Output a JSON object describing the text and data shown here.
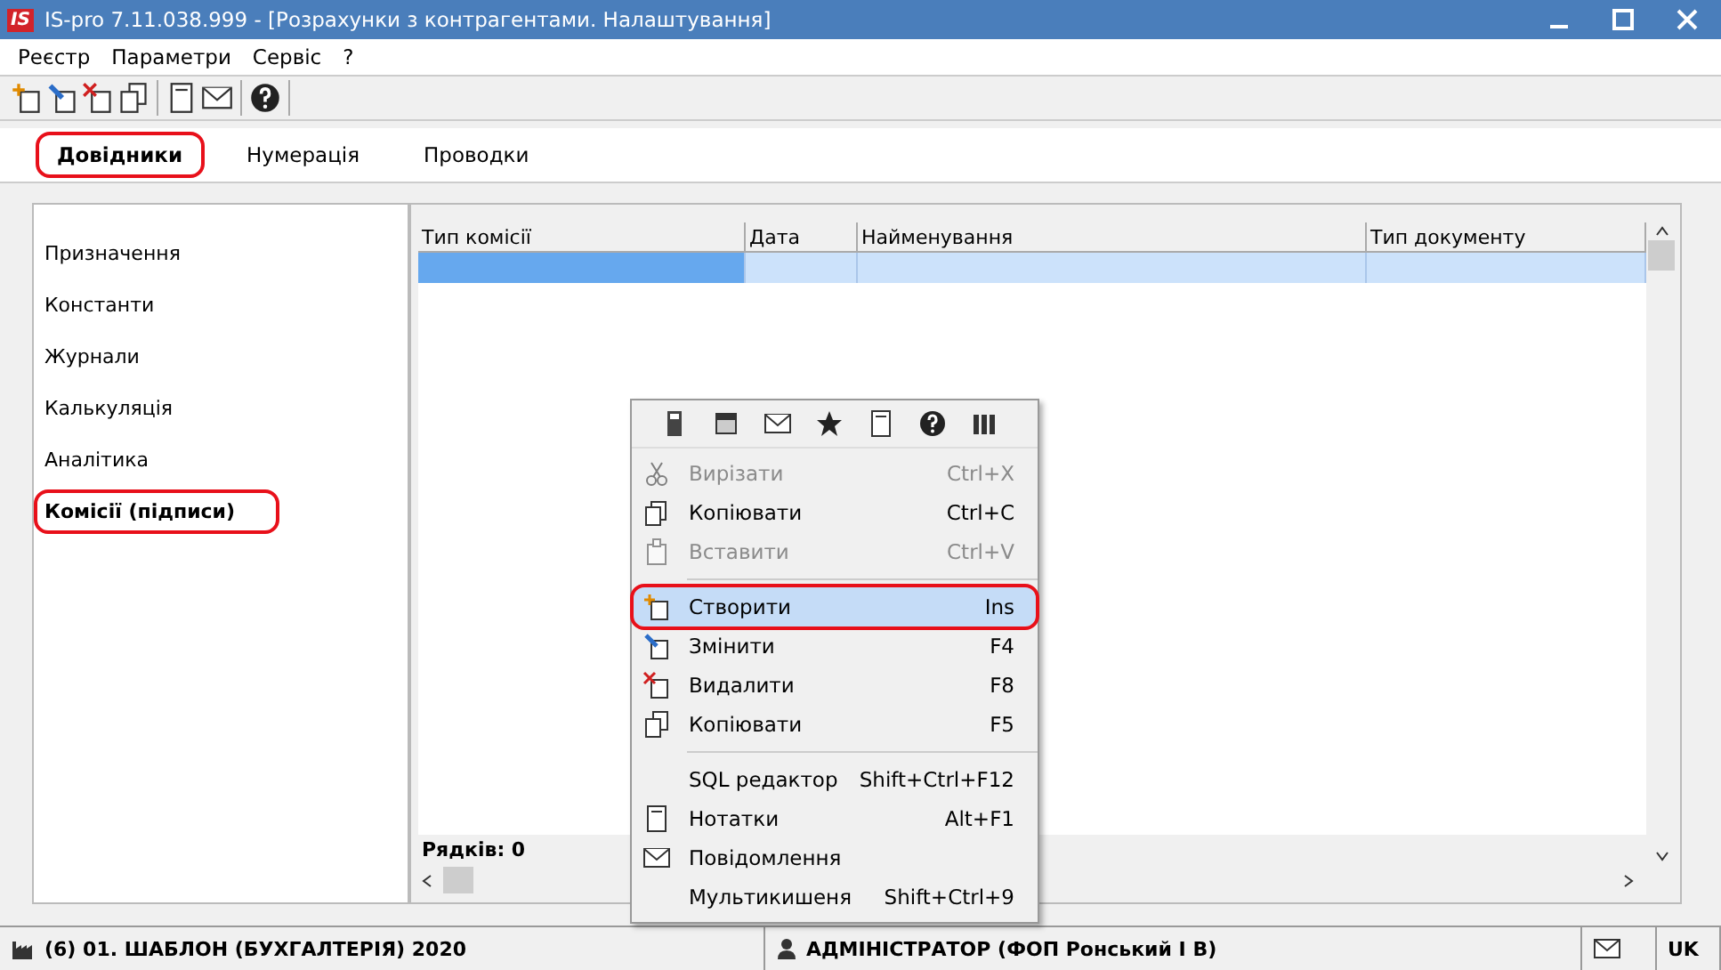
{
  "window": {
    "title": "IS-pro 7.11.038.999 - [Розрахунки з контрагентами. Налаштування]",
    "logo": "IS"
  },
  "menu": [
    "Реєстр",
    "Параметри",
    "Сервіс",
    "?"
  ],
  "tabs": [
    {
      "label": "Довідники",
      "selected": true,
      "highlighted": true
    },
    {
      "label": "Нумерація",
      "selected": false,
      "highlighted": false
    },
    {
      "label": "Проводки",
      "selected": false,
      "highlighted": false
    }
  ],
  "sidebar": {
    "items": [
      {
        "label": "Призначення",
        "selected": false,
        "highlighted": false
      },
      {
        "label": "Константи",
        "selected": false,
        "highlighted": false
      },
      {
        "label": "Журнали",
        "selected": false,
        "highlighted": false
      },
      {
        "label": "Калькуляція",
        "selected": false,
        "highlighted": false
      },
      {
        "label": "Аналітика",
        "selected": false,
        "highlighted": false
      },
      {
        "label": "Комісії (підписи)",
        "selected": true,
        "highlighted": true
      }
    ]
  },
  "table": {
    "columns": [
      "Тип комісії",
      "Дата",
      "Найменування",
      "Тип документу"
    ],
    "rows": [
      {
        "selected": true
      }
    ],
    "footer": "Рядків: 0"
  },
  "context_menu": {
    "items": [
      {
        "kind": "item",
        "label": "Вирізати",
        "shortcut": "Ctrl+X",
        "disabled": true,
        "selected": false,
        "highlighted": false
      },
      {
        "kind": "item",
        "label": "Копіювати",
        "shortcut": "Ctrl+C",
        "disabled": false,
        "selected": false,
        "highlighted": false
      },
      {
        "kind": "item",
        "label": "Вставити",
        "shortcut": "Ctrl+V",
        "disabled": true,
        "selected": false,
        "highlighted": false
      },
      {
        "kind": "separator"
      },
      {
        "kind": "item",
        "label": "Створити",
        "shortcut": "Ins",
        "disabled": false,
        "selected": true,
        "highlighted": true
      },
      {
        "kind": "item",
        "label": "Змінити",
        "shortcut": "F4",
        "disabled": false,
        "selected": false,
        "highlighted": false
      },
      {
        "kind": "item",
        "label": "Видалити",
        "shortcut": "F8",
        "disabled": false,
        "selected": false,
        "highlighted": false
      },
      {
        "kind": "item",
        "label": "Копіювати",
        "shortcut": "F5",
        "disabled": false,
        "selected": false,
        "highlighted": false
      },
      {
        "kind": "separator"
      },
      {
        "kind": "item",
        "label": "SQL редактор",
        "shortcut": "Shift+Ctrl+F12",
        "disabled": false,
        "selected": false,
        "highlighted": false
      },
      {
        "kind": "item",
        "label": "Нотатки",
        "shortcut": "Alt+F1",
        "disabled": false,
        "selected": false,
        "highlighted": false
      },
      {
        "kind": "item",
        "label": "Повідомлення",
        "disabled": false,
        "selected": false,
        "highlighted": false
      },
      {
        "kind": "item",
        "label": "Мультикишеня",
        "shortcut": "Shift+Ctrl+9",
        "disabled": false,
        "selected": false,
        "highlighted": false
      }
    ]
  },
  "status_bar": {
    "database": "(6) 01. ШАБЛОН (БУХГАЛТЕРІЯ) 2020",
    "user": "АДМІНІСТРАТОР (ФОП Ронський І В)",
    "language": "UK"
  }
}
